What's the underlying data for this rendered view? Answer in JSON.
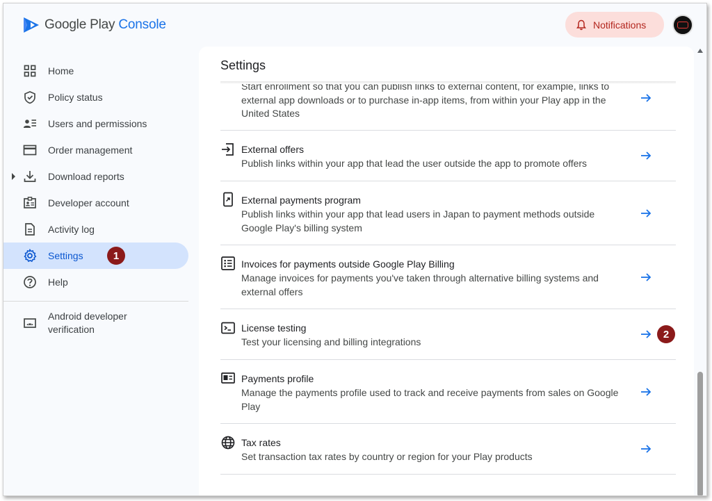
{
  "app": {
    "brand_google": "Google Play",
    "brand_console": "Console",
    "notifications_label": "Notifications"
  },
  "sidebar": {
    "items": [
      {
        "label": "Home"
      },
      {
        "label": "Policy status"
      },
      {
        "label": "Users and permissions"
      },
      {
        "label": "Order management"
      },
      {
        "label": "Download reports"
      },
      {
        "label": "Developer account"
      },
      {
        "label": "Activity log"
      },
      {
        "label": "Settings"
      },
      {
        "label": "Help"
      }
    ],
    "secondary": [
      {
        "label": "Android developer verification"
      }
    ],
    "step_badge": "1"
  },
  "main": {
    "title": "Settings",
    "partial_row_desc": "Start enrollment so that you can publish links to external content, for example, links to external app downloads or to purchase in-app items, from within your Play app in the United States",
    "rows": [
      {
        "title": "External offers",
        "desc": "Publish links within your app that lead the user outside the app to promote offers"
      },
      {
        "title": "External payments program",
        "desc": "Publish links within your app that lead users in Japan to payment methods outside Google Play's billing system"
      },
      {
        "title": "Invoices for payments outside Google Play Billing",
        "desc": "Manage invoices for payments you've taken through alternative billing systems and external offers"
      },
      {
        "title": "License testing",
        "desc": "Test your licensing and billing integrations"
      },
      {
        "title": "Payments profile",
        "desc": "Manage the payments profile used to track and receive payments from sales on Google Play"
      },
      {
        "title": "Tax rates",
        "desc": "Set transaction tax rates by country or region for your Play products"
      }
    ],
    "step_badge": "2"
  },
  "colors": {
    "accent": "#1a73e8",
    "active_nav_bg": "#d3e3fd",
    "notif_bg": "#fcdedb",
    "badge": "#8b1a1a"
  },
  "icons": {
    "home": "grid-icon",
    "policy": "shield-check-icon",
    "users": "people-list-icon",
    "orders": "card-icon",
    "download": "download-icon",
    "developer": "id-badge-icon",
    "activity": "document-icon",
    "settings": "gear-icon",
    "help": "help-circle-icon",
    "verification": "android-icon"
  }
}
